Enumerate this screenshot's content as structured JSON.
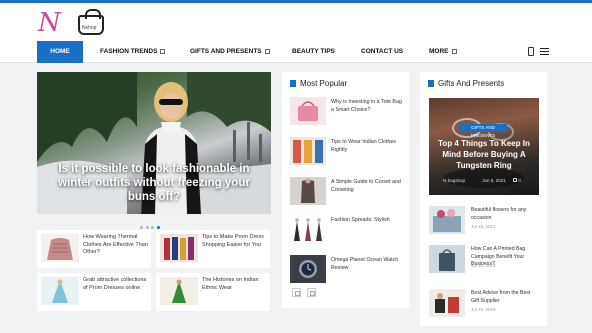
{
  "site": {
    "logo_letter": "N",
    "logo_text": "Nshop"
  },
  "nav": {
    "items": [
      {
        "label": "HOME",
        "active": true
      },
      {
        "label": "FASHION TRENDS",
        "caret": true
      },
      {
        "label": "GIFTS AND PRESENTS",
        "caret": true
      },
      {
        "label": "BEAUTY TIPS"
      },
      {
        "label": "CONTACT US"
      },
      {
        "label": "MORE",
        "caret": true
      }
    ]
  },
  "hero": {
    "caption": "Is it possible to look fashionable in winter outfits without freezing your buns off?"
  },
  "small_cards": [
    {
      "title": "How Wearing Thermal Clothes Are Effective Than Other?"
    },
    {
      "title": "Tips to Make Prom Dress Shopping Easier for You"
    },
    {
      "title": "Grab attractive collections of Prom Dresses online"
    },
    {
      "title": "The Histories on Indian Ethnic Wear"
    }
  ],
  "most_popular": {
    "heading": "Most Popular",
    "items": [
      {
        "title": "Why is Investing in a Tote Bag a Smart Choice?"
      },
      {
        "title": "Tips to Wear Indian Clothes Rightly"
      },
      {
        "title": "A Simple Guide to Corset and Corseting"
      },
      {
        "title": "Fashion Spreads: Stylish"
      },
      {
        "title": "Omega Planet Ocean Watch Review"
      }
    ]
  },
  "gifts": {
    "heading": "Gifts And Presents",
    "featured": {
      "badge": "GIFTS AND PRESENTS",
      "title": "Top 4 Things To Keep In Mind Before Buying A Tungsten Ring",
      "author": "N-bagshop",
      "date": "Jun 8, 2021",
      "comments": "0"
    },
    "items": [
      {
        "title": "Beautiful flowers for any occasion",
        "date": "Jul 18, 2021"
      },
      {
        "title": "How Can A Printed Bag Campaign Benefit Your Business?",
        "date": "Jul 18, 2019"
      },
      {
        "title": "Best Advice from the Best Gift Supplier",
        "date": "Jul 29, 2019"
      }
    ]
  },
  "colors": {
    "accent": "#1a6fc4"
  }
}
